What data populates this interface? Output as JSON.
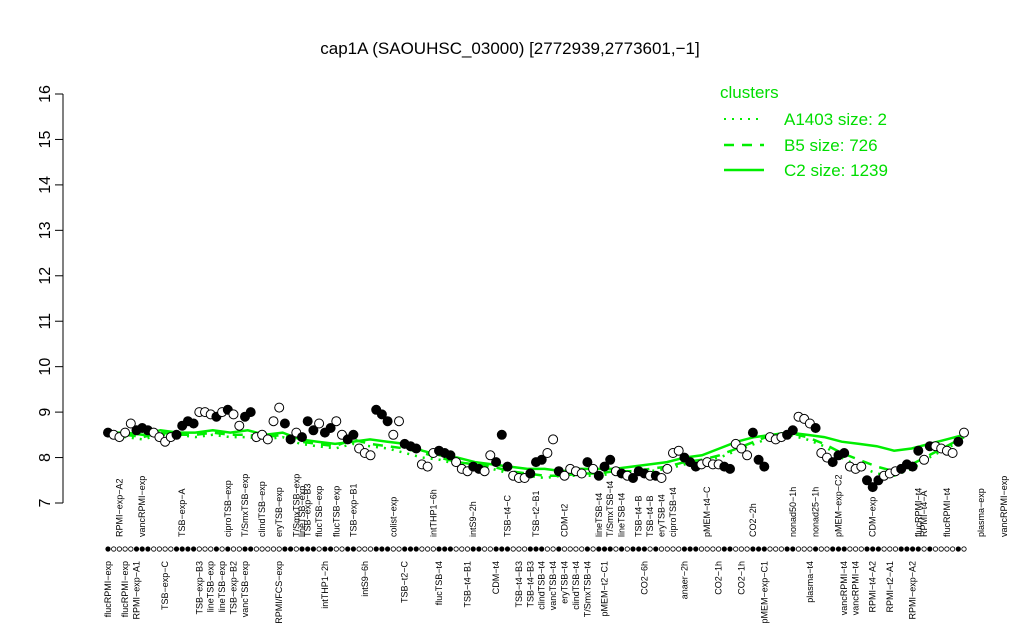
{
  "chart_data": {
    "type": "scatter",
    "title": "cap1A (SAOUHSC_03000) [2772939,2773601,−1]",
    "xlabel": "",
    "ylabel": "",
    "ylim": [
      7,
      16
    ],
    "yticks": [
      "7",
      "8",
      "9",
      "10",
      "11",
      "12",
      "13",
      "14",
      "15",
      "16"
    ],
    "legend": {
      "position": "top-right",
      "title": "clusters",
      "entries": [
        {
          "label": "A1403 size: 2",
          "style": "dotted"
        },
        {
          "label": "B5 size: 726",
          "style": "dashed"
        },
        {
          "label": "C2 size: 1239",
          "style": "solid"
        }
      ]
    },
    "colors": {
      "cluster": "#00ee00",
      "points": "#000000"
    },
    "labels_top": [
      {
        "text": "RPMI−exp−A2",
        "i": 2
      },
      {
        "text": "vancRPMI−exp",
        "i": 6
      },
      {
        "text": "TSB−exp−A",
        "i": 13
      },
      {
        "text": "ciproTSB−exp",
        "i": 21
      },
      {
        "text": "T/SmxTSB−exp",
        "i": 24
      },
      {
        "text": "clindTSB−exp",
        "i": 27
      },
      {
        "text": "eryTSB−exp",
        "i": 30
      },
      {
        "text": "T/SmxTSB−exp",
        "i": 33
      },
      {
        "text": "lineTSB−exp",
        "i": 34
      },
      {
        "text": "TSB−exp−B3",
        "i": 35
      },
      {
        "text": "flucTSB−exp",
        "i": 37
      },
      {
        "text": "flucTSB−exp",
        "i": 40
      },
      {
        "text": "TSB−exp−B1",
        "i": 43
      },
      {
        "text": "colist−exp",
        "i": 50
      },
      {
        "text": "intTHP1−6h",
        "i": 57
      },
      {
        "text": "intS9−2h",
        "i": 64
      },
      {
        "text": "TSB−t4−C",
        "i": 70
      },
      {
        "text": "TSB−t2−B1",
        "i": 75
      },
      {
        "text": "CDM−t2",
        "i": 80
      },
      {
        "text": "lineTSB−t4",
        "i": 86
      },
      {
        "text": "T/SmxTSB−t4",
        "i": 88
      },
      {
        "text": "lineTSB−t4",
        "i": 90
      },
      {
        "text": "TSB−t4−B",
        "i": 93
      },
      {
        "text": "TSB−t4−B",
        "i": 95
      },
      {
        "text": "eryTSB−t4",
        "i": 97
      },
      {
        "text": "ciproTSB−t4",
        "i": 99
      },
      {
        "text": "pMEM−t4−C",
        "i": 105
      },
      {
        "text": "CO2−2h",
        "i": 113
      },
      {
        "text": "nonad50−1h",
        "i": 120
      },
      {
        "text": "nonad25−1h",
        "i": 124
      },
      {
        "text": "pMEM−exp−C2",
        "i": 128
      },
      {
        "text": "CDM−exp",
        "i": 134
      },
      {
        "text": "flucRPMI−t4",
        "i": 142
      },
      {
        "text": "RPMI−t4−A",
        "i": 143
      },
      {
        "text": "flucRPMI−t4",
        "i": 147
      },
      {
        "text": "plasma−exp",
        "i": 153
      },
      {
        "text": "vancRPMI−exp",
        "i": 157
      }
    ],
    "labels_bottom": [
      {
        "text": "flucRPMI−exp",
        "i": 0
      },
      {
        "text": "flucRPMI−exp",
        "i": 3
      },
      {
        "text": "RPMI−exp−A1",
        "i": 5
      },
      {
        "text": "TSB−exp−C",
        "i": 10
      },
      {
        "text": "TSB−exp−B3",
        "i": 16
      },
      {
        "text": "lineTSB−exp",
        "i": 18
      },
      {
        "text": "lineTSB−exp",
        "i": 20
      },
      {
        "text": "TSB−exp−B2",
        "i": 22
      },
      {
        "text": "vancTSB−exp",
        "i": 24
      },
      {
        "text": "RPMI/FCS−exp",
        "i": 30
      },
      {
        "text": "intTHP1−2h",
        "i": 38
      },
      {
        "text": "intS9−6h",
        "i": 45
      },
      {
        "text": "TSB−t2−C",
        "i": 52
      },
      {
        "text": "flucTSB−t4",
        "i": 58
      },
      {
        "text": "TSB−t4−B1",
        "i": 63
      },
      {
        "text": "CDM−t4",
        "i": 68
      },
      {
        "text": "TSB−t4−B3",
        "i": 72
      },
      {
        "text": "TSB−t4−B3",
        "i": 74
      },
      {
        "text": "clindTSB−t4",
        "i": 76
      },
      {
        "text": "vancTSB−t4",
        "i": 78
      },
      {
        "text": "eryTSB−t4",
        "i": 80
      },
      {
        "text": "clindTSB−t4",
        "i": 82
      },
      {
        "text": "T/SmxTSB−t4",
        "i": 84
      },
      {
        "text": "pMEM−t2−C1",
        "i": 87
      },
      {
        "text": "CO2−6h",
        "i": 94
      },
      {
        "text": "anaer−2h",
        "i": 101
      },
      {
        "text": "CO2−1h",
        "i": 107
      },
      {
        "text": "CO2−1h",
        "i": 111
      },
      {
        "text": "pMEM−exp−C1",
        "i": 115
      },
      {
        "text": "plasma−t4",
        "i": 123
      },
      {
        "text": "vancRPMI−t4",
        "i": 129
      },
      {
        "text": "vancRPMI−t4",
        "i": 131
      },
      {
        "text": "RPMI−t4−A2",
        "i": 134
      },
      {
        "text": "RPMI−t2−A1",
        "i": 137
      },
      {
        "text": "RPMI−exp−A2",
        "i": 141
      }
    ],
    "points": [
      {
        "y": 8.55,
        "f": 1
      },
      {
        "y": 8.5,
        "f": 0
      },
      {
        "y": 8.45,
        "f": 0
      },
      {
        "y": 8.55,
        "f": 0
      },
      {
        "y": 8.75,
        "f": 0
      },
      {
        "y": 8.6,
        "f": 1
      },
      {
        "y": 8.65,
        "f": 1
      },
      {
        "y": 8.6,
        "f": 1
      },
      {
        "y": 8.55,
        "f": 0
      },
      {
        "y": 8.45,
        "f": 0
      },
      {
        "y": 8.35,
        "f": 0
      },
      {
        "y": 8.45,
        "f": 0
      },
      {
        "y": 8.5,
        "f": 1
      },
      {
        "y": 8.7,
        "f": 1
      },
      {
        "y": 8.8,
        "f": 1
      },
      {
        "y": 8.75,
        "f": 1
      },
      {
        "y": 9.0,
        "f": 0
      },
      {
        "y": 9.0,
        "f": 0
      },
      {
        "y": 8.95,
        "f": 0
      },
      {
        "y": 8.9,
        "f": 1
      },
      {
        "y": 9.0,
        "f": 0
      },
      {
        "y": 9.05,
        "f": 1
      },
      {
        "y": 8.95,
        "f": 0
      },
      {
        "y": 8.7,
        "f": 0
      },
      {
        "y": 8.9,
        "f": 1
      },
      {
        "y": 9.0,
        "f": 1
      },
      {
        "y": 8.45,
        "f": 0
      },
      {
        "y": 8.5,
        "f": 0
      },
      {
        "y": 8.4,
        "f": 0
      },
      {
        "y": 8.8,
        "f": 0
      },
      {
        "y": 9.1,
        "f": 0
      },
      {
        "y": 8.75,
        "f": 1
      },
      {
        "y": 8.4,
        "f": 1
      },
      {
        "y": 8.55,
        "f": 0
      },
      {
        "y": 8.45,
        "f": 1
      },
      {
        "y": 8.8,
        "f": 1
      },
      {
        "y": 8.6,
        "f": 1
      },
      {
        "y": 8.75,
        "f": 0
      },
      {
        "y": 8.55,
        "f": 1
      },
      {
        "y": 8.65,
        "f": 1
      },
      {
        "y": 8.8,
        "f": 0
      },
      {
        "y": 8.5,
        "f": 0
      },
      {
        "y": 8.4,
        "f": 1
      },
      {
        "y": 8.5,
        "f": 1
      },
      {
        "y": 8.2,
        "f": 0
      },
      {
        "y": 8.1,
        "f": 0
      },
      {
        "y": 8.05,
        "f": 0
      },
      {
        "y": 9.05,
        "f": 1
      },
      {
        "y": 8.95,
        "f": 1
      },
      {
        "y": 8.8,
        "f": 1
      },
      {
        "y": 8.5,
        "f": 0
      },
      {
        "y": 8.8,
        "f": 0
      },
      {
        "y": 8.3,
        "f": 1
      },
      {
        "y": 8.25,
        "f": 1
      },
      {
        "y": 8.2,
        "f": 1
      },
      {
        "y": 7.85,
        "f": 0
      },
      {
        "y": 7.8,
        "f": 0
      },
      {
        "y": 8.1,
        "f": 0
      },
      {
        "y": 8.15,
        "f": 1
      },
      {
        "y": 8.1,
        "f": 1
      },
      {
        "y": 8.05,
        "f": 1
      },
      {
        "y": 7.9,
        "f": 0
      },
      {
        "y": 7.75,
        "f": 0
      },
      {
        "y": 7.7,
        "f": 0
      },
      {
        "y": 7.8,
        "f": 1
      },
      {
        "y": 7.75,
        "f": 1
      },
      {
        "y": 7.7,
        "f": 0
      },
      {
        "y": 8.05,
        "f": 0
      },
      {
        "y": 7.9,
        "f": 1
      },
      {
        "y": 8.5,
        "f": 1
      },
      {
        "y": 7.8,
        "f": 1
      },
      {
        "y": 7.6,
        "f": 0
      },
      {
        "y": 7.55,
        "f": 0
      },
      {
        "y": 7.55,
        "f": 0
      },
      {
        "y": 7.65,
        "f": 1
      },
      {
        "y": 7.9,
        "f": 1
      },
      {
        "y": 7.95,
        "f": 1
      },
      {
        "y": 8.1,
        "f": 0
      },
      {
        "y": 8.4,
        "f": 0
      },
      {
        "y": 7.7,
        "f": 1
      },
      {
        "y": 7.6,
        "f": 0
      },
      {
        "y": 7.75,
        "f": 0
      },
      {
        "y": 7.7,
        "f": 0
      },
      {
        "y": 7.65,
        "f": 0
      },
      {
        "y": 7.9,
        "f": 1
      },
      {
        "y": 7.75,
        "f": 0
      },
      {
        "y": 7.6,
        "f": 1
      },
      {
        "y": 7.8,
        "f": 1
      },
      {
        "y": 7.95,
        "f": 1
      },
      {
        "y": 7.7,
        "f": 0
      },
      {
        "y": 7.65,
        "f": 1
      },
      {
        "y": 7.6,
        "f": 0
      },
      {
        "y": 7.55,
        "f": 1
      },
      {
        "y": 7.7,
        "f": 1
      },
      {
        "y": 7.65,
        "f": 1
      },
      {
        "y": 7.6,
        "f": 0
      },
      {
        "y": 7.6,
        "f": 1
      },
      {
        "y": 7.55,
        "f": 0
      },
      {
        "y": 7.75,
        "f": 0
      },
      {
        "y": 8.1,
        "f": 0
      },
      {
        "y": 8.15,
        "f": 0
      },
      {
        "y": 8.0,
        "f": 1
      },
      {
        "y": 7.9,
        "f": 1
      },
      {
        "y": 7.8,
        "f": 1
      },
      {
        "y": 7.85,
        "f": 0
      },
      {
        "y": 7.9,
        "f": 0
      },
      {
        "y": 7.85,
        "f": 0
      },
      {
        "y": 7.85,
        "f": 0
      },
      {
        "y": 7.8,
        "f": 1
      },
      {
        "y": 7.75,
        "f": 1
      },
      {
        "y": 8.3,
        "f": 0
      },
      {
        "y": 8.2,
        "f": 0
      },
      {
        "y": 8.05,
        "f": 0
      },
      {
        "y": 8.55,
        "f": 1
      },
      {
        "y": 7.95,
        "f": 1
      },
      {
        "y": 7.8,
        "f": 1
      },
      {
        "y": 8.45,
        "f": 0
      },
      {
        "y": 8.4,
        "f": 0
      },
      {
        "y": 8.45,
        "f": 0
      },
      {
        "y": 8.5,
        "f": 1
      },
      {
        "y": 8.6,
        "f": 1
      },
      {
        "y": 8.9,
        "f": 0
      },
      {
        "y": 8.85,
        "f": 0
      },
      {
        "y": 8.75,
        "f": 0
      },
      {
        "y": 8.65,
        "f": 1
      },
      {
        "y": 8.1,
        "f": 0
      },
      {
        "y": 8.0,
        "f": 0
      },
      {
        "y": 7.9,
        "f": 1
      },
      {
        "y": 8.05,
        "f": 1
      },
      {
        "y": 8.1,
        "f": 1
      },
      {
        "y": 7.8,
        "f": 0
      },
      {
        "y": 7.75,
        "f": 0
      },
      {
        "y": 7.8,
        "f": 0
      },
      {
        "y": 7.5,
        "f": 1
      },
      {
        "y": 7.35,
        "f": 1
      },
      {
        "y": 7.5,
        "f": 1
      },
      {
        "y": 7.6,
        "f": 0
      },
      {
        "y": 7.65,
        "f": 0
      },
      {
        "y": 7.7,
        "f": 0
      },
      {
        "y": 7.75,
        "f": 1
      },
      {
        "y": 7.85,
        "f": 1
      },
      {
        "y": 7.8,
        "f": 1
      },
      {
        "y": 8.15,
        "f": 1
      },
      {
        "y": 7.95,
        "f": 0
      },
      {
        "y": 8.25,
        "f": 1
      },
      {
        "y": 8.25,
        "f": 0
      },
      {
        "y": 8.2,
        "f": 0
      },
      {
        "y": 8.15,
        "f": 0
      },
      {
        "y": 8.1,
        "f": 0
      },
      {
        "y": 8.35,
        "f": 1
      },
      {
        "y": 8.55,
        "f": 0
      }
    ],
    "lines": {
      "C2": [
        8.55,
        8.55,
        8.5,
        8.6,
        8.55,
        8.55,
        8.6,
        8.55,
        8.6,
        8.5,
        8.55,
        8.4,
        8.35,
        8.3,
        8.35,
        8.4,
        8.35,
        8.3,
        8.15,
        8.05,
        8.0,
        7.9,
        7.85,
        7.8,
        7.75,
        7.75,
        7.7,
        7.75,
        7.75,
        7.75,
        7.8,
        7.85,
        7.9,
        8.0,
        8.05,
        8.2,
        8.35,
        8.45,
        8.5,
        8.55,
        8.5,
        8.45,
        8.35,
        8.3,
        8.25,
        8.15,
        8.2,
        8.3,
        8.4,
        8.5
      ],
      "B5": [
        8.55,
        8.5,
        8.45,
        8.55,
        8.5,
        8.5,
        8.55,
        8.5,
        8.5,
        8.45,
        8.5,
        8.35,
        8.3,
        8.25,
        8.4,
        8.3,
        8.25,
        8.2,
        8.1,
        8.0,
        7.9,
        7.85,
        7.8,
        7.7,
        7.65,
        7.6,
        7.6,
        7.65,
        7.65,
        7.7,
        7.7,
        7.75,
        7.8,
        7.9,
        7.95,
        8.05,
        8.2,
        8.35,
        8.5,
        8.55,
        8.45,
        8.3,
        8.1,
        7.95,
        7.8,
        7.7,
        7.85,
        8.05,
        8.25,
        8.45
      ],
      "A1403": [
        8.5,
        8.45,
        8.4,
        8.5,
        8.5,
        8.45,
        8.5,
        8.45,
        8.45,
        8.4,
        8.45,
        8.3,
        8.25,
        8.2,
        8.3,
        8.25,
        8.2,
        8.1,
        8.0,
        7.95,
        7.85,
        7.8,
        7.75,
        7.65,
        7.6,
        7.55,
        7.6,
        7.6,
        7.6,
        7.65,
        7.7,
        7.7,
        7.75,
        7.85,
        7.9,
        8.0,
        8.15,
        8.3,
        8.45,
        8.5,
        8.4,
        8.25,
        8.0,
        7.8,
        7.65,
        7.6,
        7.75,
        8.0,
        8.2,
        8.4
      ]
    }
  }
}
